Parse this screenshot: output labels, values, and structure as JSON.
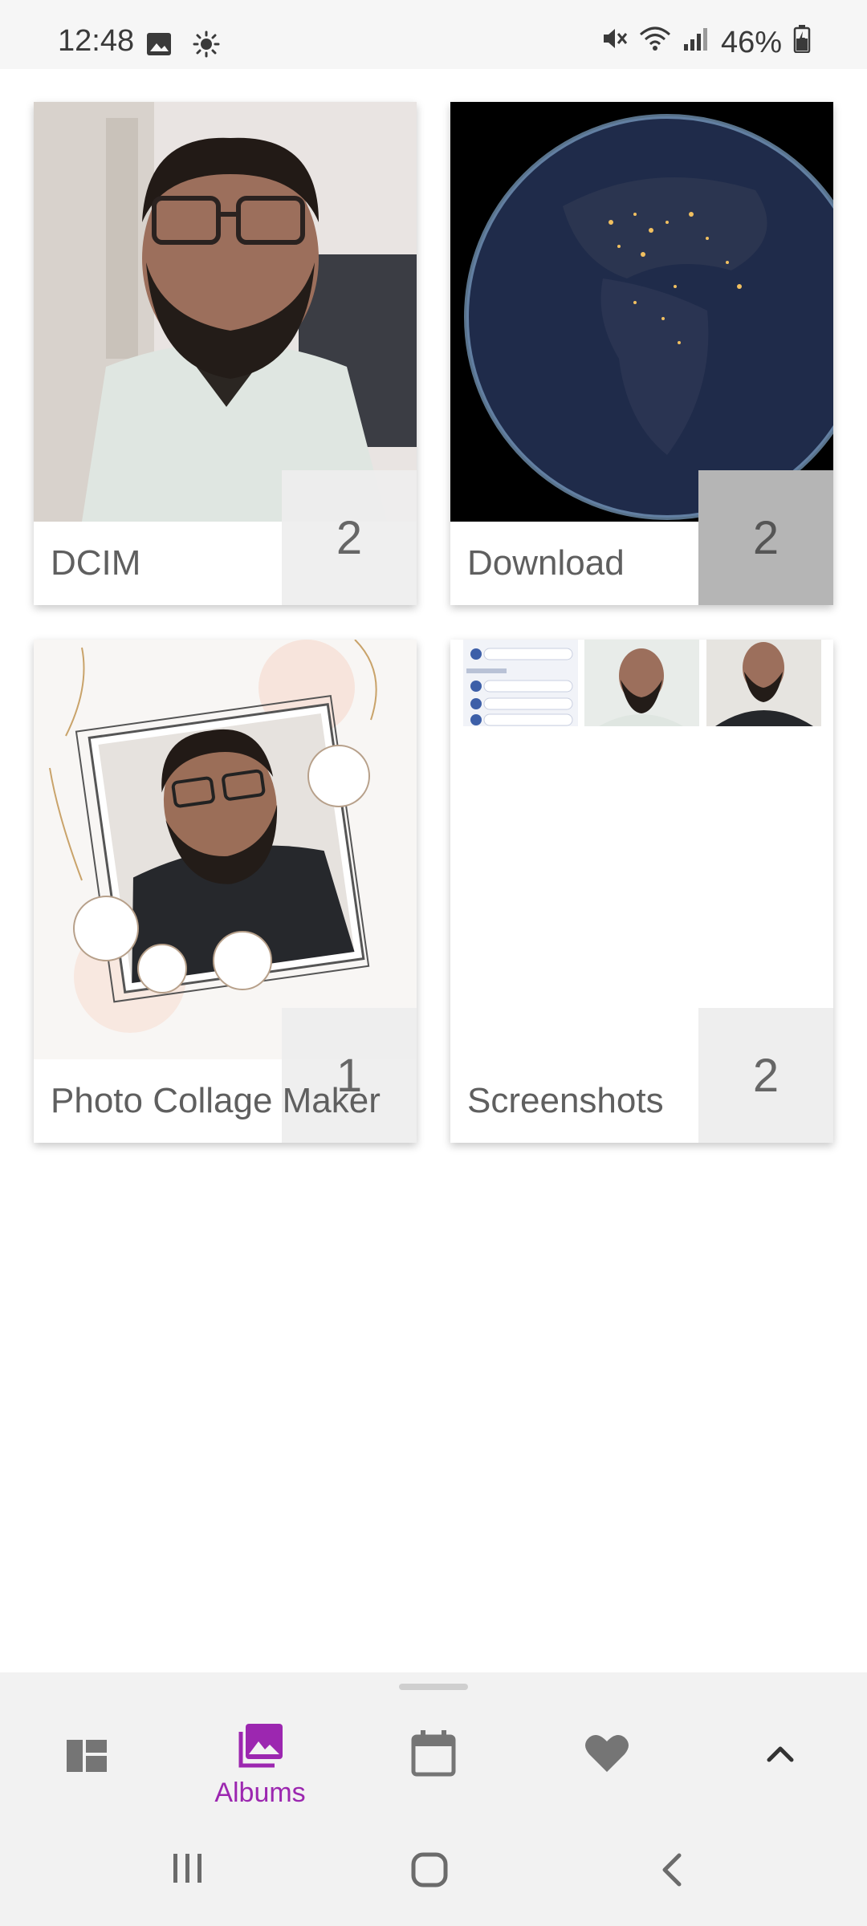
{
  "status_bar": {
    "time": "12:48",
    "battery": "46%",
    "icons": [
      "image-icon",
      "brightness-icon",
      "mute-icon",
      "wifi-icon",
      "signal-icon",
      "battery-icon"
    ]
  },
  "albums": [
    {
      "name": "DCIM",
      "count": "2"
    },
    {
      "name": "Download",
      "count": "2"
    },
    {
      "name": "Photo Collage Maker",
      "count": "1"
    },
    {
      "name": "Screenshots",
      "count": "2"
    }
  ],
  "bottom_nav": {
    "items": [
      {
        "icon": "dashboard-icon"
      },
      {
        "icon": "albums-icon",
        "label": "Albums",
        "active": true
      },
      {
        "icon": "calendar-icon"
      },
      {
        "icon": "heart-icon"
      },
      {
        "icon": "chevron-up-icon"
      }
    ],
    "accent": "#9c27b0"
  },
  "system_nav": [
    "recents-icon",
    "home-icon",
    "back-icon"
  ]
}
